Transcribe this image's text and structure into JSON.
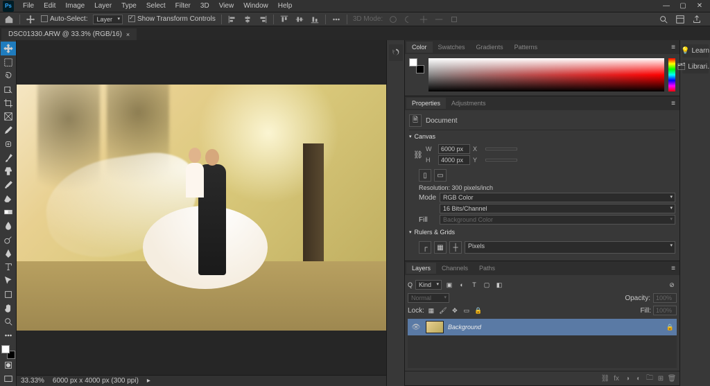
{
  "app": {
    "logo": "Ps"
  },
  "menubar": [
    "File",
    "Edit",
    "Image",
    "Layer",
    "Type",
    "Select",
    "Filter",
    "3D",
    "View",
    "Window",
    "Help"
  ],
  "optionsbar": {
    "auto_select_label": "Auto-Select:",
    "auto_select_target": "Layer",
    "show_transform_label": "Show Transform Controls",
    "threeD_mode": "3D Mode:"
  },
  "document": {
    "tab_label": "DSC01330.ARW @ 33.3% (RGB/16)"
  },
  "statusbar": {
    "zoom": "33.33%",
    "doc_info": "6000 px x 4000 px (300 ppi)"
  },
  "panels": {
    "color": {
      "tabs": [
        "Color",
        "Swatches",
        "Gradients",
        "Patterns"
      ]
    },
    "properties": {
      "tabs": [
        "Properties",
        "Adjustments"
      ],
      "doc_label": "Document",
      "canvas_label": "Canvas",
      "width_label": "W",
      "width_value": "6000 px",
      "height_label": "H",
      "height_value": "4000 px",
      "x_label": "X",
      "x_value": "",
      "y_label": "Y",
      "y_value": "",
      "resolution": "Resolution: 300 pixels/inch",
      "mode_label": "Mode",
      "mode_value": "RGB Color",
      "depth_value": "16 Bits/Channel",
      "fill_label": "Fill",
      "fill_value": "Background Color",
      "rulers_label": "Rulers & Grids",
      "units_value": "Pixels"
    },
    "layers": {
      "tabs": [
        "Layers",
        "Channels",
        "Paths"
      ],
      "kind_label": "Kind",
      "blend_mode": "Normal",
      "opacity_label": "Opacity:",
      "opacity_value": "100%",
      "lock_label": "Lock:",
      "fill_label": "Fill:",
      "fill_value": "100%",
      "items": [
        {
          "name": "Background",
          "visible": true,
          "locked": true
        }
      ]
    },
    "right_rail": {
      "learn": "Learn",
      "libraries": "Librari..."
    }
  }
}
